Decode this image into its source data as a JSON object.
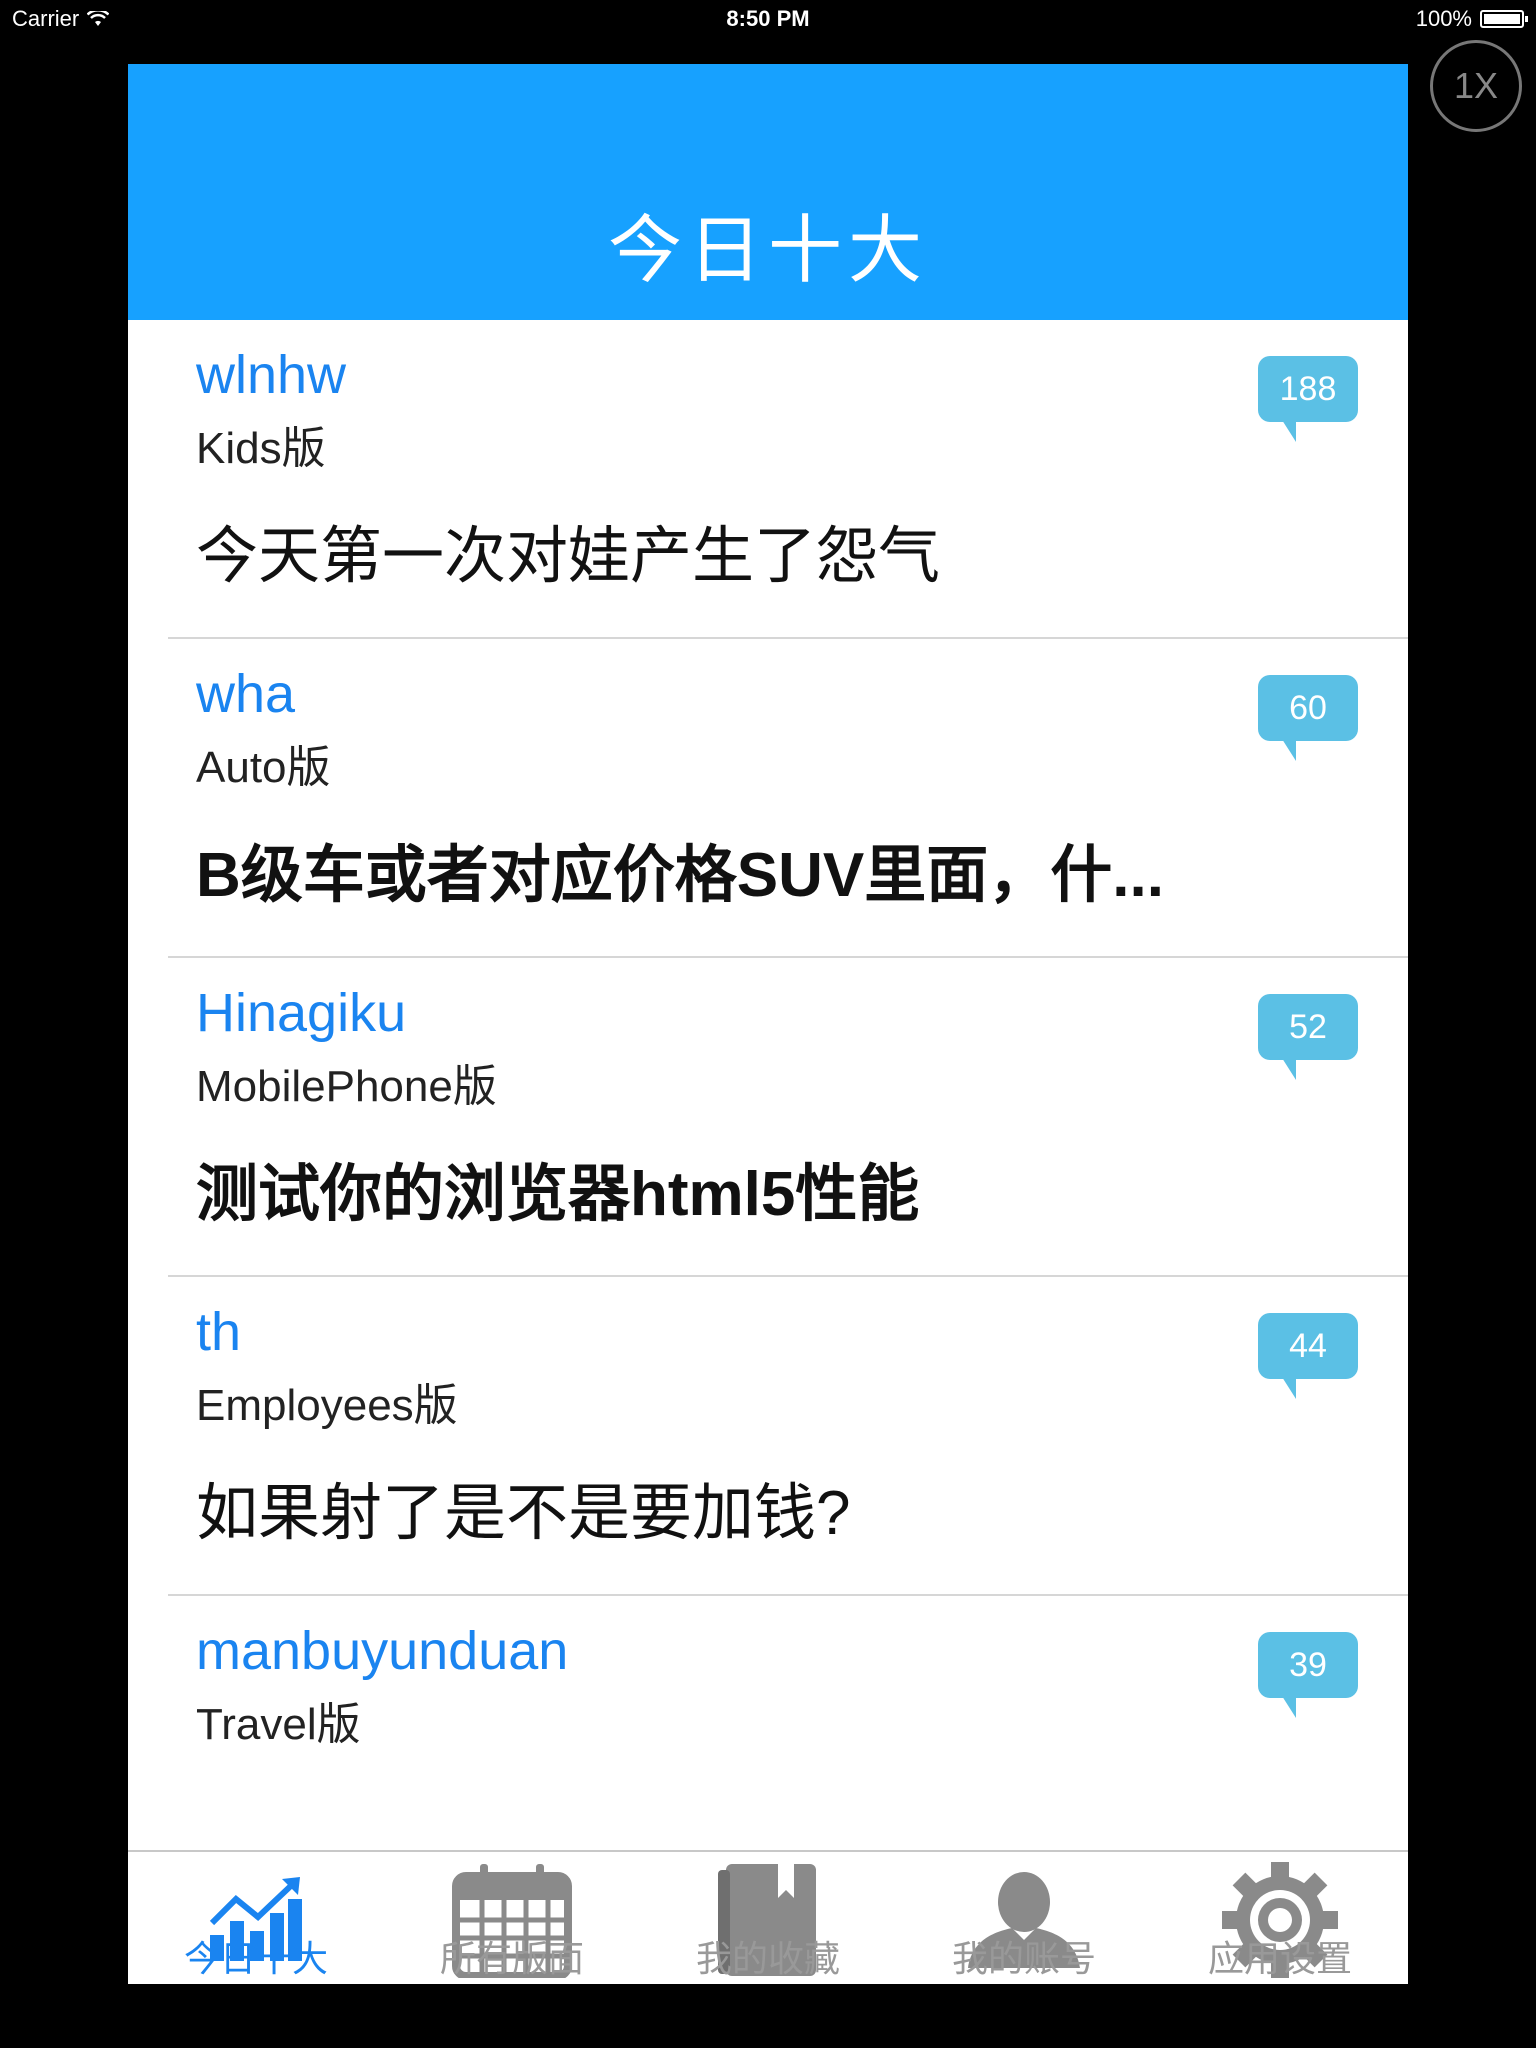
{
  "status_bar": {
    "carrier": "Carrier",
    "time": "8:50 PM",
    "battery": "100%"
  },
  "zoom_button": {
    "label": "1X"
  },
  "nav": {
    "title": "今日十大"
  },
  "colors": {
    "nav_bar": "#17a1ff",
    "author_text": "#1a84f0",
    "reply_badge": "#5bc0e5",
    "tab_active": "#1a84f0",
    "tab_inactive": "#999999"
  },
  "topics": [
    {
      "author": "wlnhw",
      "board": "Kids版",
      "title": "今天第一次对娃产生了怨气",
      "replies": "188"
    },
    {
      "author": "wha",
      "board": "Auto版",
      "title": "B级车或者对应价格SUV里面，什...",
      "replies": "60"
    },
    {
      "author": "Hinagiku",
      "board": "MobilePhone版",
      "title": "测试你的浏览器html5性能",
      "replies": "52"
    },
    {
      "author": "th",
      "board": "Employees版",
      "title": "如果射了是不是要加钱?",
      "replies": "44"
    },
    {
      "author": "manbuyunduan",
      "board": "Travel版",
      "title": "",
      "replies": "39"
    }
  ],
  "tabs": [
    {
      "label": "今日十大",
      "icon": "chart-icon",
      "active": true
    },
    {
      "label": "所有版面",
      "icon": "calendar-icon",
      "active": false
    },
    {
      "label": "我的收藏",
      "icon": "book-icon",
      "active": false
    },
    {
      "label": "我的账号",
      "icon": "person-icon",
      "active": false
    },
    {
      "label": "应用设置",
      "icon": "gear-icon",
      "active": false
    }
  ]
}
